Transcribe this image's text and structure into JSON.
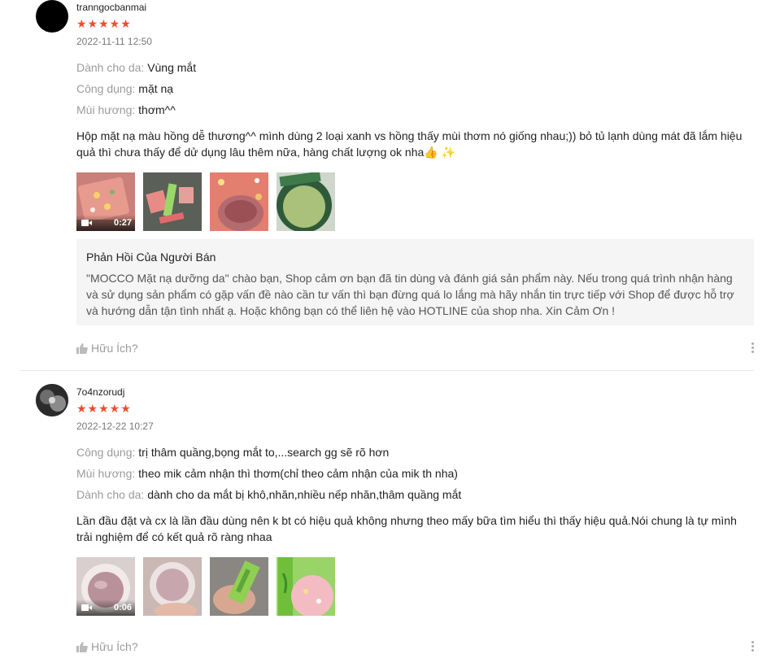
{
  "reviews": [
    {
      "username": "tranngocbanmai",
      "stars": "★★★★★",
      "rating": 5,
      "date": "2022-11-11 12:50",
      "attributes": [
        {
          "key": "Dành cho da:",
          "value": "Vùng mắt"
        },
        {
          "key": "Công dụng:",
          "value": "mặt nạ"
        },
        {
          "key": "Mùi hương:",
          "value": "thơm^^"
        }
      ],
      "content_line1": "Hộp mặt nạ màu hồng dễ thương^^ mình dùng 2 loại xanh vs hồng thấy mùi thơm nó giống nhau;)) bỏ tủ lạnh dùng mát đã lắm hiệu",
      "content_line2": "quả thì chưa thấy để dử dụng lâu thêm nữa, hàng chất lượng ok nha👍 ✨",
      "video_duration": "0:27",
      "seller_reply": {
        "title": "Phản Hồi Của Người Bán",
        "line1": "\"MOCCO Mặt nạ dưỡng da\" chào bạn, Shop cảm ơn bạn đã tin dùng và đánh giá sản phẩm này. Nếu trong quá trình nhận hàng",
        "line2": "và sử dụng sản phẩm có gặp vấn đề nào cần tư vấn thì bạn đừng quá lo lắng mà hãy nhắn tin trực tiếp với Shop để được hỗ trợ",
        "line3": "và hướng dẫn tận tình nhất ạ. Hoặc không bạn có thể liên hệ vào HOTLINE của shop nha. Xin Cảm Ơn !"
      },
      "helpful_label": "Hữu Ích?"
    },
    {
      "username": "7o4nzorudj",
      "stars": "★★★★★",
      "rating": 5,
      "date": "2022-12-22 10:27",
      "attributes": [
        {
          "key": "Công dụng:",
          "value": "trị thâm quầng,bọng mắt to,...search gg sẽ rõ hơn"
        },
        {
          "key": "Mùi hương:",
          "value": "theo mik cảm nhận thì thơm(chỉ theo cảm nhận của mik th nha)"
        },
        {
          "key": "Dành cho da:",
          "value": "dành cho da mắt bị khô,nhăn,nhiều nếp nhăn,thâm quầng mắt"
        }
      ],
      "content_line1": "Lần đầu đặt và cx là lần đầu dùng nên k bt có hiệu quả không nhưng theo mấy bữa tìm hiểu thì thấy hiệu quả.Nói chung là tự mình",
      "content_line2": "trải nghiệm để có kết quả rõ ràng nhaa",
      "video_duration": "0:06",
      "helpful_label": "Hữu Ích?"
    }
  ],
  "colors": {
    "star": "#ee4d2d",
    "muted": "#999999",
    "reply_bg": "#f5f5f5"
  },
  "icons": [
    "thumbs-up-icon",
    "more-vertical-icon",
    "video-camera-icon",
    "star-icon"
  ]
}
